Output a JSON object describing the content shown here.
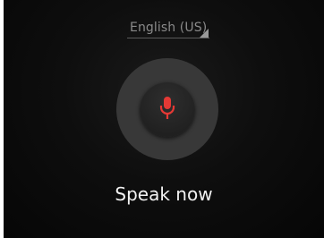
{
  "language_selector": {
    "selected": "English (US)"
  },
  "mic": {
    "icon": "microphone-icon",
    "icon_color": "#e53935"
  },
  "prompt": {
    "text": "Speak now"
  }
}
